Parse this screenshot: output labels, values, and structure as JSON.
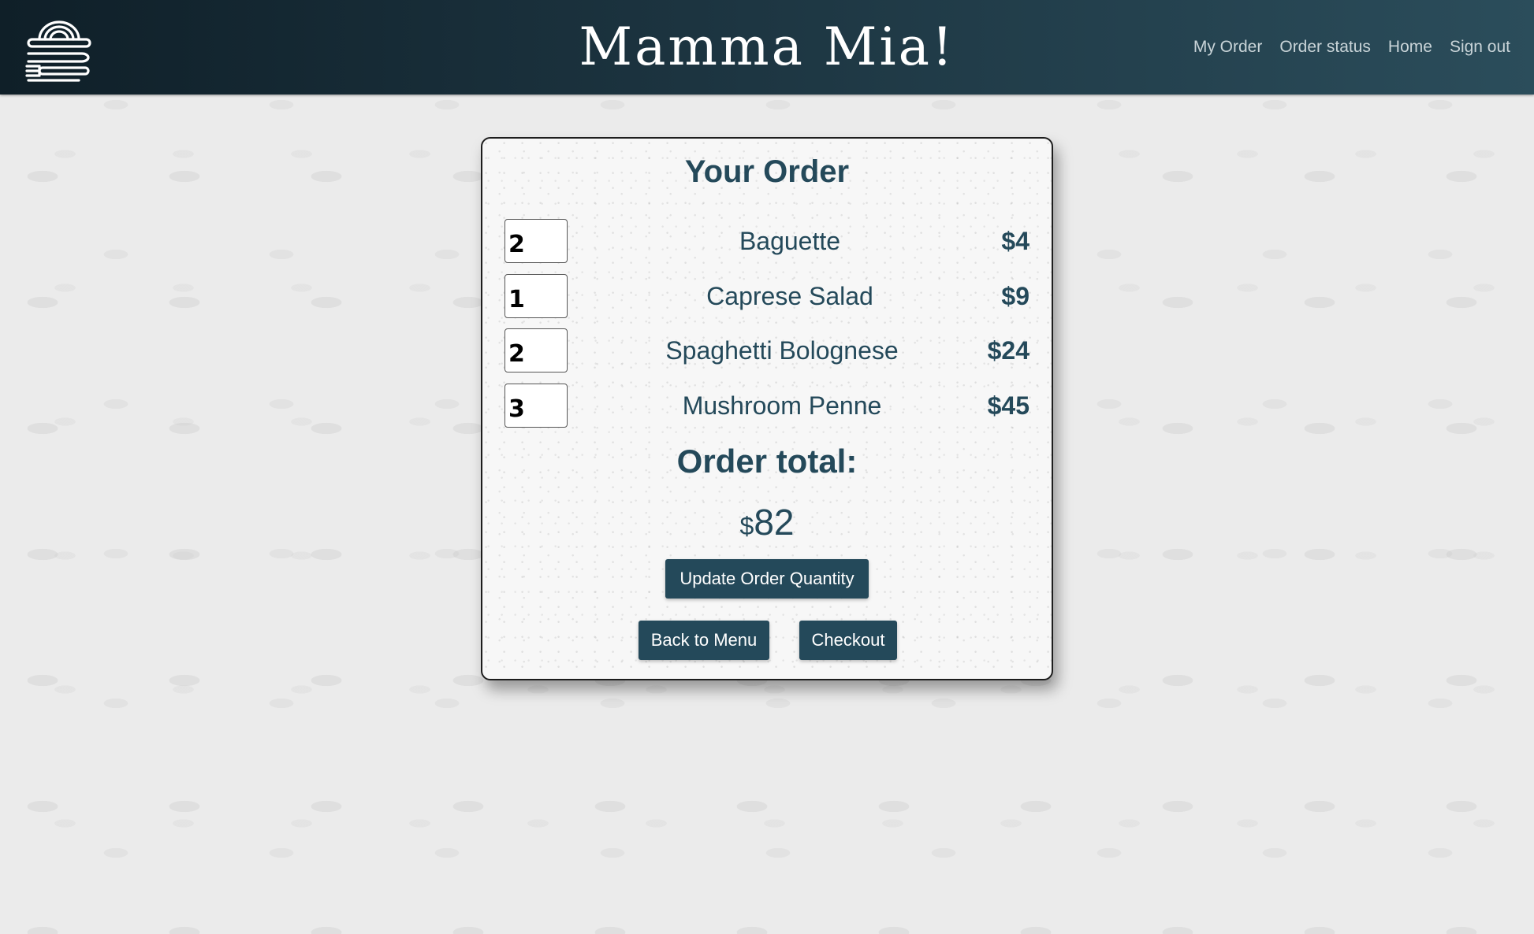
{
  "header": {
    "title": "Mamma Mia!",
    "nav": [
      {
        "label": "My Order"
      },
      {
        "label": "Order status"
      },
      {
        "label": "Home"
      },
      {
        "label": "Sign out"
      }
    ]
  },
  "order": {
    "heading": "Your Order",
    "items": [
      {
        "qty": "2",
        "name": "Baguette",
        "price": "$4"
      },
      {
        "qty": "1",
        "name": "Caprese Salad",
        "price": "$9"
      },
      {
        "qty": "2",
        "name": "Spaghetti Bolognese",
        "price": "$24"
      },
      {
        "qty": "3",
        "name": "Mushroom Penne",
        "price": "$45"
      }
    ],
    "total_label": "Order total:",
    "total_currency": "$",
    "total_amount": "82",
    "update_button": "Update Order Quantity",
    "back_button": "Back to Menu",
    "checkout_button": "Checkout"
  },
  "icons": {
    "logo": "pasta-plate-utensils-icon"
  },
  "colors": {
    "header_dark": "#0f1f28",
    "header_light": "#2b4d5b",
    "accent": "#24495a",
    "page_bg": "#ebebeb"
  }
}
